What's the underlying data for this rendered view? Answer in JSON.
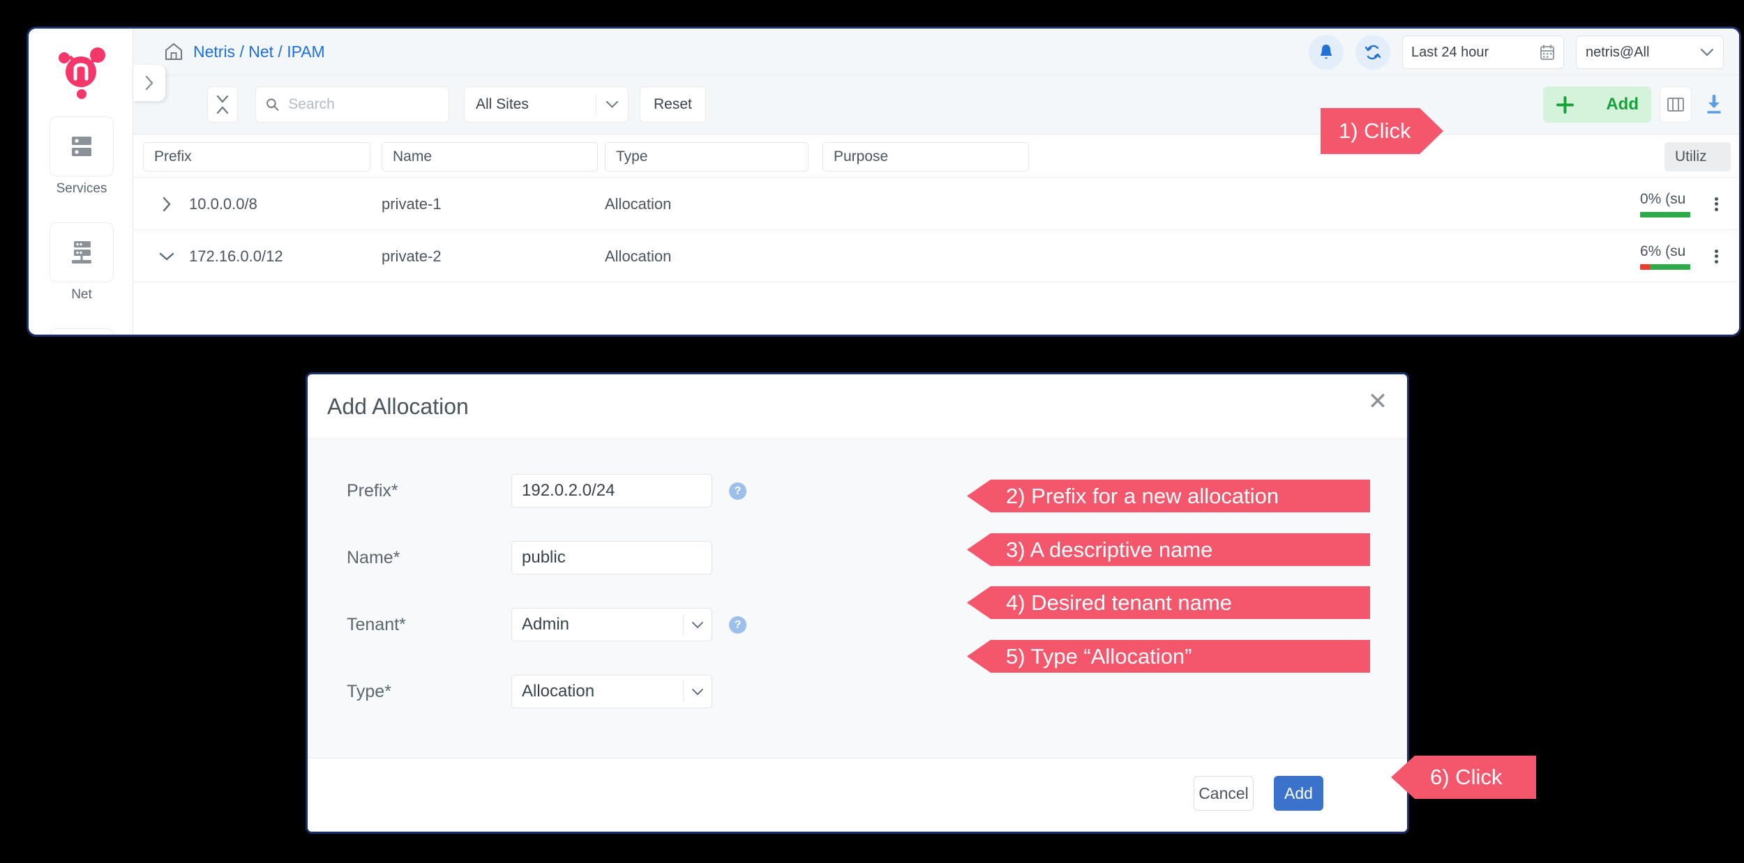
{
  "app": {
    "brand": "netris-logo",
    "sidebar": {
      "items": [
        {
          "label": "Services",
          "icon": "server-stack-icon"
        },
        {
          "label": "Net",
          "icon": "network-rack-icon"
        }
      ]
    },
    "topbar": {
      "breadcrumb": "Netris / Net / IPAM",
      "home_icon": "home-icon",
      "notifications_icon": "bell-icon",
      "refresh_icon": "refresh-icon",
      "daterange_value": "Last 24 hour",
      "calendar_icon": "calendar-icon",
      "tenant_value": "netris@All",
      "chevron_icon": "chevron-down-icon"
    },
    "filterbar": {
      "collapse_icon": "collapse-rows-icon",
      "search_placeholder": "Search",
      "search_value": "",
      "search_icon": "search-icon",
      "sites_value": "All Sites",
      "reset_label": "Reset",
      "add_label": "Add",
      "add_plus_icon": "plus-icon",
      "columns_icon": "columns-icon",
      "download_icon": "download-icon"
    },
    "table": {
      "column_filters": [
        "Prefix",
        "Name",
        "Type",
        "Purpose"
      ],
      "utilization_header": "Utiliz",
      "rows": [
        {
          "expander": "chevron-right-icon",
          "prefix": "10.0.0.0/8",
          "name": "private-1",
          "type": "Allocation",
          "purpose": "",
          "utilization_text": "0% (su",
          "utilization_used_pct": 0
        },
        {
          "expander": "chevron-down-icon",
          "prefix": "172.16.0.0/12",
          "name": "private-2",
          "type": "Allocation",
          "purpose": "",
          "utilization_text": "6% (su",
          "utilization_used_pct": 20
        }
      ]
    }
  },
  "modal": {
    "title": "Add Allocation",
    "close_icon": "close-icon",
    "fields": [
      {
        "label": "Prefix*",
        "value": "192.0.2.0/24",
        "kind": "input",
        "help": true
      },
      {
        "label": "Name*",
        "value": "public",
        "kind": "input",
        "help": false
      },
      {
        "label": "Tenant*",
        "value": "Admin",
        "kind": "select",
        "help": true
      },
      {
        "label": "Type*",
        "value": "Allocation",
        "kind": "select",
        "help": false
      }
    ],
    "cancel_label": "Cancel",
    "add_label": "Add"
  },
  "callouts": [
    {
      "text": "1) Click",
      "direction": "right"
    },
    {
      "text": "2) Prefix for a new allocation",
      "direction": "left"
    },
    {
      "text": "3) A descriptive name",
      "direction": "left"
    },
    {
      "text": "4) Desired tenant name",
      "direction": "left"
    },
    {
      "text": "5) Type “Allocation”",
      "direction": "left"
    },
    {
      "text": "6) Click",
      "direction": "left"
    }
  ],
  "colors": {
    "brand_pink": "#f4366a",
    "callout_red": "#f4566c",
    "accent_blue": "#1d6fe0",
    "add_green": "#17a13a",
    "util_green": "#2eaa4a",
    "util_red": "#ef3b2d",
    "window_border": "#1b2f6b"
  }
}
